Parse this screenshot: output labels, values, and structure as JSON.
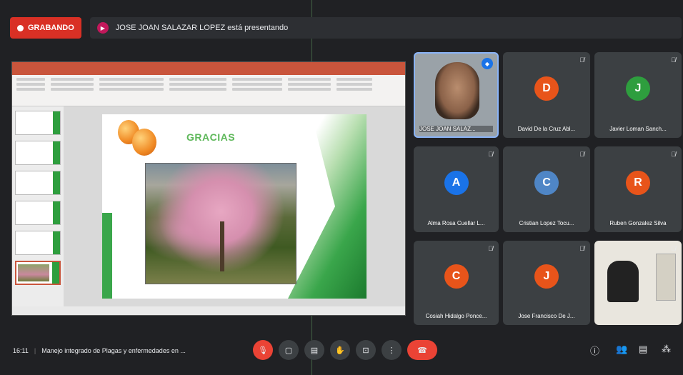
{
  "topbar": {
    "recording_label": "GRABANDO",
    "presenting_text": "JOSE JOAN SALAZAR LOPEZ está presentando"
  },
  "slide": {
    "title": "GRACIAS"
  },
  "participants": [
    {
      "name": "JOSE JOAN SALAZ...",
      "type": "video"
    },
    {
      "name": "David De la Cruz Abl...",
      "initial": "D",
      "color": "#e8541a"
    },
    {
      "name": "Javier Loman Sanch...",
      "initial": "J",
      "color": "#2e9e3e"
    },
    {
      "name": "Alma Rosa Cuellar L...",
      "initial": "A",
      "color": "#1a73e8"
    },
    {
      "name": "Cristian Lopez Tocu...",
      "initial": "C",
      "color": "#4f86c6"
    },
    {
      "name": "Ruben Gonzalez Silva",
      "initial": "R",
      "color": "#e8541a"
    },
    {
      "name": "Cosiah Hidalgo Ponce...",
      "initial": "C",
      "color": "#e8541a"
    },
    {
      "name": "Jose Francisco De J...",
      "initial": "J",
      "color": "#e8541a"
    },
    {
      "name": "",
      "type": "camera"
    }
  ],
  "bottombar": {
    "time": "16:11",
    "meeting_title": "Manejo integrado de Plagas y enfermedades en ..."
  },
  "icons": [
    "mic-off-icon",
    "camera-off-icon",
    "captions-icon",
    "raise-hand-icon",
    "present-icon",
    "more-options-icon",
    "hang-up-icon",
    "info-icon",
    "people-icon",
    "chat-icon",
    "activities-icon"
  ]
}
